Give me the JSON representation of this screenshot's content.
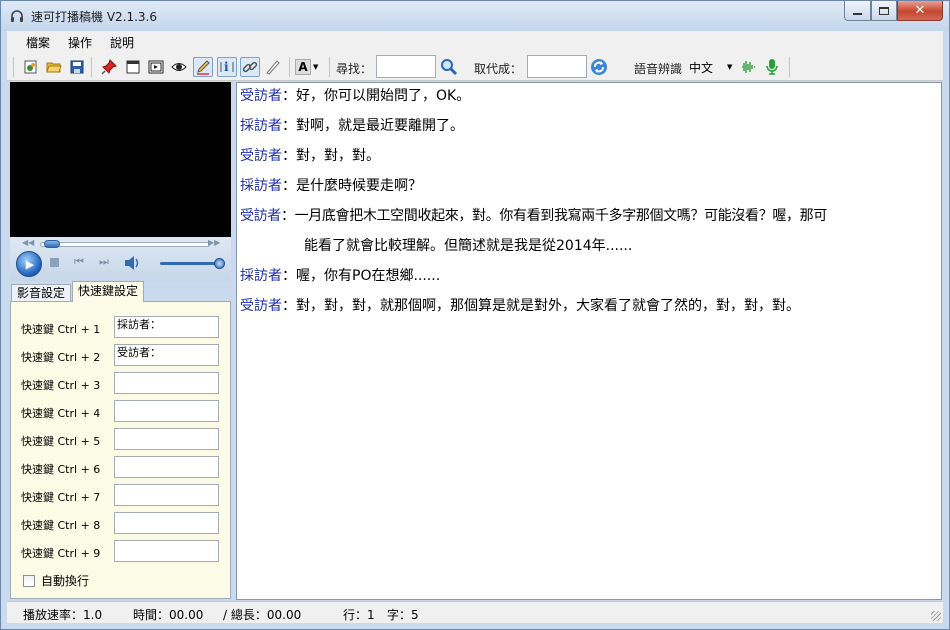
{
  "window": {
    "title": "速可打播稿機 V2.1.3.6"
  },
  "menu": {
    "items": [
      "檔案",
      "操作",
      "說明"
    ]
  },
  "toolbar": {
    "font_label": "A",
    "find_label": "尋找：",
    "find_value": "",
    "replace_label": "取代成：",
    "replace_value": "",
    "speech_label": "語音辨識",
    "speech_language": "中文"
  },
  "tabs": [
    {
      "label": "影音設定"
    },
    {
      "label": "快速鍵設定"
    }
  ],
  "shortcuts": [
    {
      "label": "快速鍵 Ctrl + 1",
      "value": "採訪者："
    },
    {
      "label": "快速鍵 Ctrl + 2",
      "value": "受訪者："
    },
    {
      "label": "快速鍵 Ctrl + 3",
      "value": ""
    },
    {
      "label": "快速鍵 Ctrl + 4",
      "value": ""
    },
    {
      "label": "快速鍵 Ctrl + 5",
      "value": ""
    },
    {
      "label": "快速鍵 Ctrl + 6",
      "value": ""
    },
    {
      "label": "快速鍵 Ctrl + 7",
      "value": ""
    },
    {
      "label": "快速鍵 Ctrl + 8",
      "value": ""
    },
    {
      "label": "快速鍵 Ctrl + 9",
      "value": ""
    }
  ],
  "auto_wrap_label": "自動換行",
  "transcript": [
    {
      "speaker": "受訪者",
      "text": "：好，你可以開始問了，OK。"
    },
    {
      "speaker": "採訪者",
      "text": "：對啊，就是最近要離開了。"
    },
    {
      "speaker": "受訪者",
      "text": "：對，對，對。"
    },
    {
      "speaker": "採訪者",
      "text": "：是什麼時候要走啊？"
    },
    {
      "speaker": "受訪者",
      "text": "：一月底會把木工空間收起來，對。你有看到我寫兩千多字那個文嗎？可能沒看？喔，那可",
      "cont": "能看了就會比較理解。但簡述就是我是從2014年......"
    },
    {
      "speaker": "採訪者",
      "text": "：喔，你有PO在想鄉......"
    },
    {
      "speaker": "受訪者",
      "text": "：對，對，對，就那個啊，那個算是就是對外，大家看了就會了然的，對，對，對。"
    }
  ],
  "status": {
    "speed": "播放速率：1.0",
    "time": "時間：00.00",
    "total": "/ 總長：00.00",
    "line": "行：1",
    "char": "字：5"
  },
  "colors": {
    "speaker": "#1f2fa8",
    "shortcut_panel_bg": "#fcfbe6"
  }
}
